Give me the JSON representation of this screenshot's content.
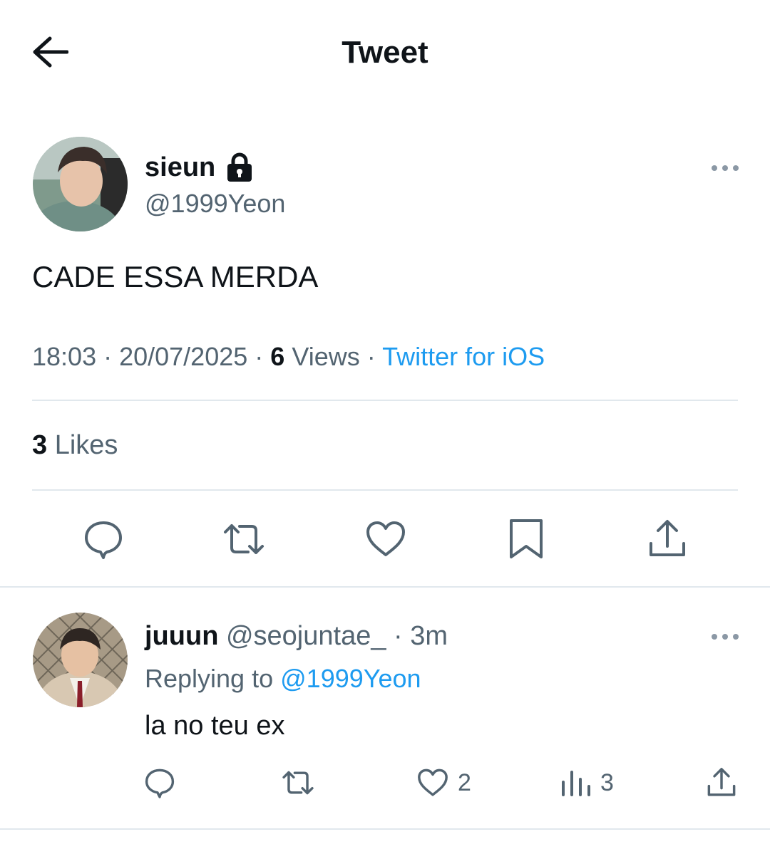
{
  "header": {
    "title": "Tweet",
    "back_icon": "arrow-left-icon"
  },
  "tweet": {
    "author_name": "sieun",
    "protected_icon": "lock-icon",
    "handle": "@1999Yeon",
    "text": "CADE ESSA MERDA",
    "time": "18:03",
    "date": "20/07/2025",
    "views_count": "6",
    "views_label": "Views",
    "source": "Twitter for iOS",
    "likes_count": "3",
    "likes_label": "Likes",
    "actions": [
      "reply-icon",
      "retweet-icon",
      "like-icon",
      "bookmark-icon",
      "share-icon"
    ]
  },
  "reply": {
    "author_name": "juuun",
    "handle": "@seojuntae_",
    "time": "3m",
    "replying_label": "Replying to",
    "replying_to": "@1999Yeon",
    "text": "la no teu ex",
    "like_count": "2",
    "views_count": "3"
  },
  "colors": {
    "accent": "#1d9bf0",
    "secondary_text": "#536471",
    "divider": "#e1e8ed"
  }
}
